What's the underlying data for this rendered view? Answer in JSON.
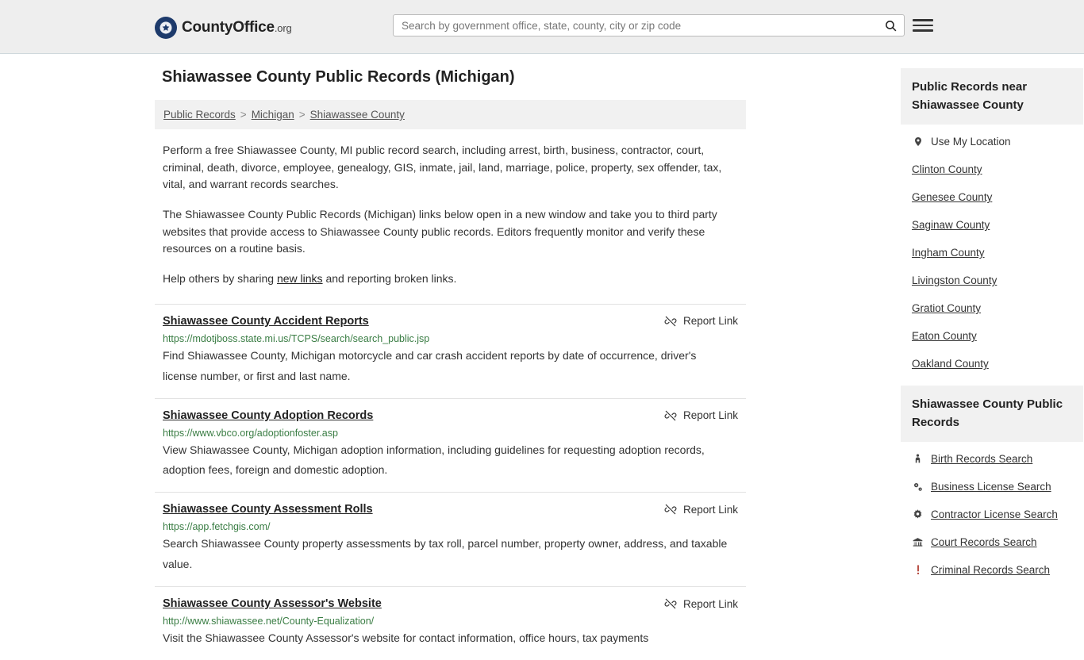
{
  "header": {
    "logo": {
      "brand_first": "County",
      "brand_second": "Office",
      "brand_tld": ".org",
      "icon": "shield-star-icon"
    },
    "search": {
      "placeholder": "Search by government office, state, county, city or zip code",
      "value": "",
      "button_icon": "search-icon"
    },
    "menu_icon": "hamburger-menu-icon"
  },
  "page": {
    "title": "Shiawassee County Public Records (Michigan)"
  },
  "breadcrumb": {
    "items": [
      {
        "label": "Public Records"
      },
      {
        "label": "Michigan"
      },
      {
        "label": "Shiawassee County"
      }
    ],
    "separator": ">"
  },
  "intro": {
    "paragraph1": "Perform a free Shiawassee County, MI public record search, including arrest, birth, business, contractor, court, criminal, death, divorce, employee, genealogy, GIS, inmate, jail, land, marriage, police, property, sex offender, tax, vital, and warrant records searches.",
    "paragraph2": "The Shiawassee County Public Records (Michigan) links below open in a new window and take you to third party websites that provide access to Shiawassee County public records. Editors frequently monitor and verify these resources on a routine basis.",
    "paragraph3_prefix": "Help others by sharing ",
    "paragraph3_link": "new links",
    "paragraph3_suffix": " and reporting broken links."
  },
  "results": {
    "report_label": "Report Link",
    "report_icon": "broken-link-icon",
    "items": [
      {
        "title": "Shiawassee County Accident Reports",
        "url": "https://mdotjboss.state.mi.us/TCPS/search/search_public.jsp",
        "description": "Find Shiawassee County, Michigan motorcycle and car crash accident reports by date of occurrence, driver's license number, or first and last name."
      },
      {
        "title": "Shiawassee County Adoption Records",
        "url": "https://www.vbco.org/adoptionfoster.asp",
        "description": "View Shiawassee County, Michigan adoption information, including guidelines for requesting adoption records, adoption fees, foreign and domestic adoption."
      },
      {
        "title": "Shiawassee County Assessment Rolls",
        "url": "https://app.fetchgis.com/",
        "description": "Search Shiawassee County property assessments by tax roll, parcel number, property owner, address, and taxable value."
      },
      {
        "title": "Shiawassee County Assessor's Website",
        "url": "http://www.shiawassee.net/County-Equalization/",
        "description": "Visit the Shiawassee County Assessor's website for contact information, office hours, tax payments"
      }
    ]
  },
  "sidebar": {
    "nearby": {
      "heading": "Public Records near Shiawassee County",
      "use_my_location": {
        "label": "Use My Location",
        "icon": "map-pin-icon"
      },
      "counties": [
        "Clinton County",
        "Genesee County",
        "Saginaw County",
        "Ingham County",
        "Livingston County",
        "Gratiot County",
        "Eaton County",
        "Oakland County"
      ]
    },
    "records": {
      "heading": "Shiawassee County Public Records",
      "items": [
        {
          "label": "Birth Records Search",
          "icon": "baby-icon"
        },
        {
          "label": "Business License Search",
          "icon": "gears-icon"
        },
        {
          "label": "Contractor License Search",
          "icon": "gear-icon"
        },
        {
          "label": "Court Records Search",
          "icon": "courthouse-icon"
        },
        {
          "label": "Criminal Records Search",
          "icon": "exclamation-icon"
        }
      ]
    }
  },
  "colors": {
    "header_bg": "#eeeeee",
    "breadcrumb_bg": "#f1f1f1",
    "url_green": "#3a7d44",
    "logo_blue": "#1d3a6b"
  }
}
